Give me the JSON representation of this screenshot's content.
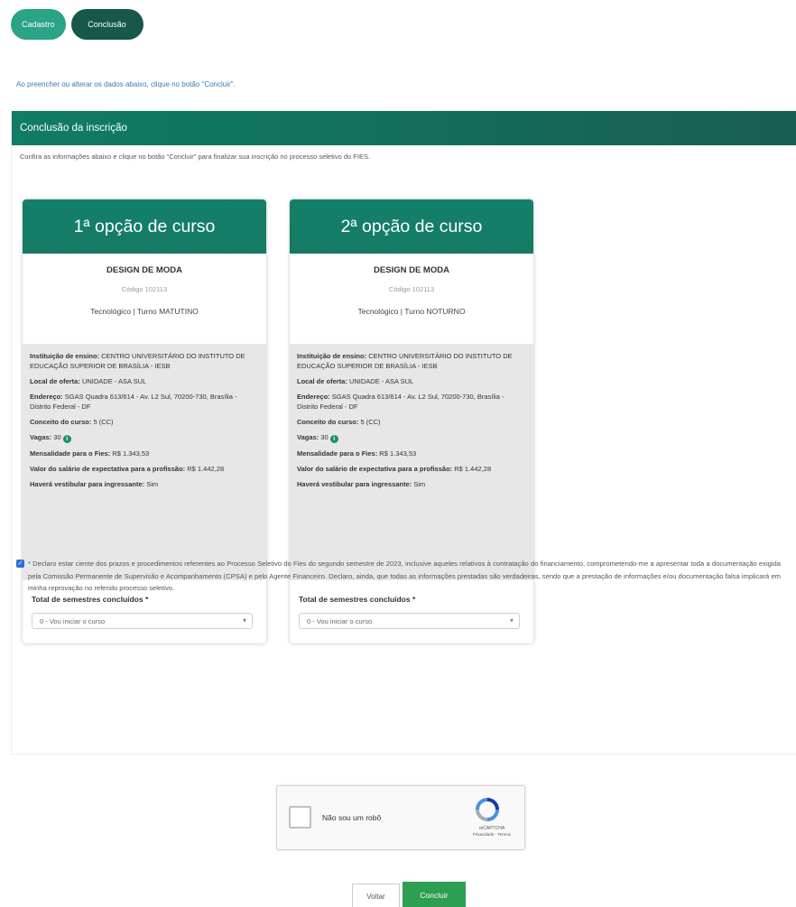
{
  "steps": {
    "cadastro": "Cadastro",
    "conclusao": "Conclusão"
  },
  "notice": "Ao preencher ou alterar os dados abaixo, clique no botão \"Concluir\".",
  "panel": {
    "title": "Conclusão da inscrição",
    "intro": "Confira as informações abaixo e clique no botão \"Concluir\" para finalizar sua inscrição no processo seletivo do FIES."
  },
  "courses": [
    {
      "header": "1ª opção de curso",
      "name": "DESIGN DE MODA",
      "code": "Código 102113",
      "type": "Tecnológico | Turno MATUTINO",
      "institution_label": "Instituição de ensino:",
      "institution": "CENTRO UNIVERSITÁRIO DO INSTITUTO DE EDUCAÇÃO SUPERIOR DE BRASÍLIA - IESB",
      "location_label": "Local de oferta:",
      "location": "UNIDADE - ASA SUL",
      "address_label": "Endereço:",
      "address": "SGAS Quadra 613/614 - Av. L2 Sul, 70200-730, Brasília - Distrito Federal - DF",
      "concept_label": "Conceito do curso:",
      "concept": "5 (CC)",
      "vacancies_label": "Vagas:",
      "vacancies": "30",
      "tuition_label": "Mensalidade para o Fies:",
      "tuition": "R$ 1.343,53",
      "salary_label": "Valor do salário de expectativa para a profissão:",
      "salary": "R$ 1.442,28",
      "exam_label": "Haverá vestibular para ingressante:",
      "exam": "Sim",
      "semesters_label": "Total de semestres concluídos *",
      "semesters_value": "0 - Vou iniciar o curso"
    },
    {
      "header": "2ª opção de curso",
      "name": "DESIGN DE MODA",
      "code": "Código 102113",
      "type": "Tecnológico | Turno NOTURNO",
      "institution_label": "Instituição de ensino:",
      "institution": "CENTRO UNIVERSITÁRIO DO INSTITUTO DE EDUCAÇÃO SUPERIOR DE BRASÍLIA - IESB",
      "location_label": "Local de oferta:",
      "location": "UNIDADE - ASA SUL",
      "address_label": "Endereço:",
      "address": "SGAS Quadra 613/614 - Av. L2 Sul, 70200-730, Brasília - Distrito Federal - DF",
      "concept_label": "Conceito do curso:",
      "concept": "5 (CC)",
      "vacancies_label": "Vagas:",
      "vacancies": "30",
      "tuition_label": "Mensalidade para o Fies:",
      "tuition": "R$ 1.343,53",
      "salary_label": "Valor do salário de expectativa para a profissão:",
      "salary": "R$ 1.442,28",
      "exam_label": "Haverá vestibular para ingressante:",
      "exam": "Sim",
      "semesters_label": "Total de semestres concluídos *",
      "semesters_value": "0 - Vou iniciar o curso"
    }
  ],
  "declaration": {
    "checked": true,
    "text": "* Declaro estar ciente dos prazos e procedimentos referentes ao Processo Seletivo do Fies do segundo semestre de 2023, inclusive aqueles relativos à contratação do financiamento, comprometendo-me a apresentar toda a documentação exigida pela Comissão Permanente de Supervisão e Acompanhamento (CPSA) e pelo Agente Financeiro. Declaro, ainda, que todas as informações prestadas são verdadeiras, sendo que a prestação de informações e/ou documentação falsa implicará em minha reprovação no referido processo seletivo."
  },
  "captcha": {
    "label": "Não sou um robô",
    "brand": "reCAPTCHA",
    "links": "Privacidade - Termos"
  },
  "buttons": {
    "voltar": "Voltar",
    "concluir": "Concluir"
  },
  "colors": {
    "header_green": "#14806a",
    "dark_green": "#17584a",
    "button_green": "#2e9e53",
    "link_blue": "#3a78b8"
  }
}
